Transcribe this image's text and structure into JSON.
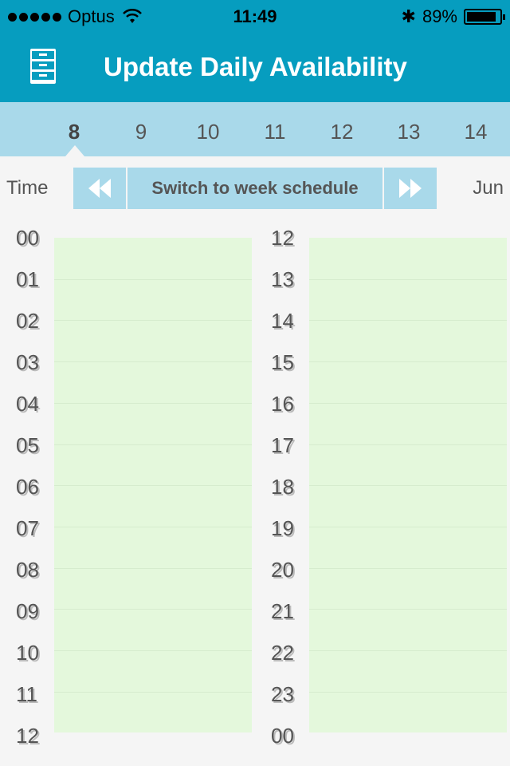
{
  "status_bar": {
    "carrier": "Optus",
    "time": "11:49",
    "battery": "89%",
    "battery_level": 0.89,
    "signal_bars": 5
  },
  "header": {
    "title": "Update Daily Availability",
    "icon": "cabinet-icon"
  },
  "days": {
    "items": [
      "8",
      "9",
      "10",
      "11",
      "12",
      "13",
      "14"
    ],
    "selected": "8"
  },
  "controls": {
    "time_label": "Time",
    "switch_label": "Switch to week schedule",
    "month_label": "Jun",
    "prev_icon": "rewind-icon",
    "next_icon": "fast-forward-icon"
  },
  "schedule": {
    "left_hours": [
      "00",
      "01",
      "02",
      "03",
      "04",
      "05",
      "06",
      "07",
      "08",
      "09",
      "10",
      "11",
      "12"
    ],
    "right_hours": [
      "12",
      "13",
      "14",
      "15",
      "16",
      "17",
      "18",
      "19",
      "20",
      "21",
      "22",
      "23",
      "00"
    ]
  },
  "colors": {
    "header": "#069dbf",
    "strip": "#a9d9ea",
    "grid": "#e4f8dc"
  }
}
